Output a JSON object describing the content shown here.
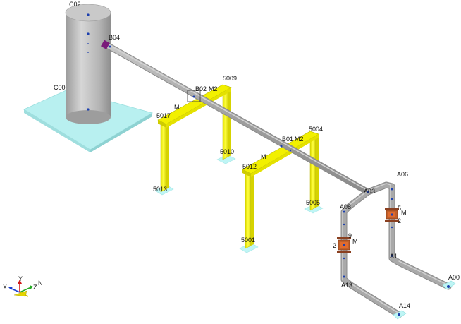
{
  "colors": {
    "background": "#ffffff",
    "tank": "#b9b9b9",
    "tank_base": "#b8f0f0",
    "pipe": "#a6a6a6",
    "support_steel": "#f2f000",
    "support_base": "#bff5f5",
    "valve": "#c0602a",
    "node_marker": "#1b3fae",
    "nozzle": "#7a1a7a"
  },
  "labels": {
    "tank_top": "C02",
    "tank_base": "C00",
    "nozzle": "B04",
    "pipe_support_1": "B02",
    "pipe_support_1_tag": "M2",
    "pipe_support_1_m": "M",
    "pipe_support_2": "B01",
    "pipe_support_2_tag": "M2",
    "pipe_support_2_m": "M",
    "frame1_top_right": "5009",
    "frame1_top_left": "5017",
    "frame1_base_right": "5010",
    "frame1_base_left": "5013",
    "frame2_top_right": "5004",
    "frame2_top_left": "5012",
    "frame2_base_right": "5005",
    "frame2_base_left": "5001",
    "riser_top": "A06",
    "riser_elbow": "A03",
    "valve_right_a": "5",
    "valve_right_b": "2",
    "valve_right_m": "M",
    "left_top": "A08",
    "valve_left_a": "9",
    "valve_left_b": "2",
    "valve_left_m": "M",
    "bottom_left": "A13",
    "bottom_right": "A1",
    "end_right": "A00",
    "end_left": "A14"
  },
  "axis_triad": {
    "x": "X",
    "y": "Y",
    "z": "Z",
    "n": "N",
    "colors": {
      "x": "#1a3fd1",
      "y": "#d11a1a",
      "z": "#22aa22",
      "n": "#d6c400"
    }
  }
}
